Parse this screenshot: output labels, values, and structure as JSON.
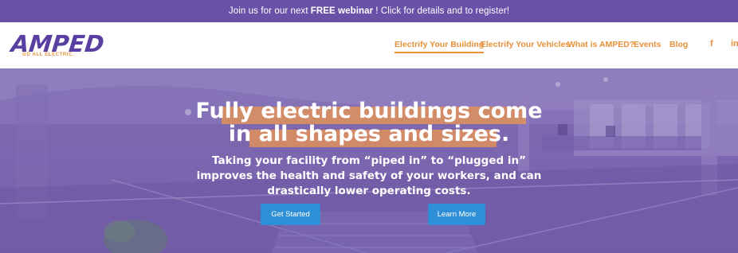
{
  "announcement": {
    "before": "Join us for our next",
    "bold": "FREE webinar",
    "after": "! Click for details and to register!"
  },
  "logo": {
    "name": "AMPED",
    "tagline": "GO ALL ELECTRIC."
  },
  "nav": {
    "items": [
      {
        "label": "Electrify Your Building",
        "active": true
      },
      {
        "label": "Electrify Your Vehicles",
        "active": false
      },
      {
        "label": "What is AMPED?",
        "active": false
      },
      {
        "label": "Events",
        "active": false
      },
      {
        "label": "Blog",
        "active": false
      }
    ],
    "social": [
      "f",
      "in"
    ]
  },
  "hero": {
    "headline_line1": "Fully electric buildings come",
    "headline_line2": "in all shapes and sizes.",
    "sub_line1": "Taking your facility from “piped in” to “plugged in”",
    "sub_line2": "improves the health and safety of your workers, and can",
    "sub_line3": "drastically lower operating costs.",
    "btn_primary": "Get Started",
    "btn_secondary": "Learn More"
  },
  "colors": {
    "brand_purple": "#6a51a8",
    "accent_orange": "#e8913a",
    "button_blue": "#2f8fd6"
  }
}
